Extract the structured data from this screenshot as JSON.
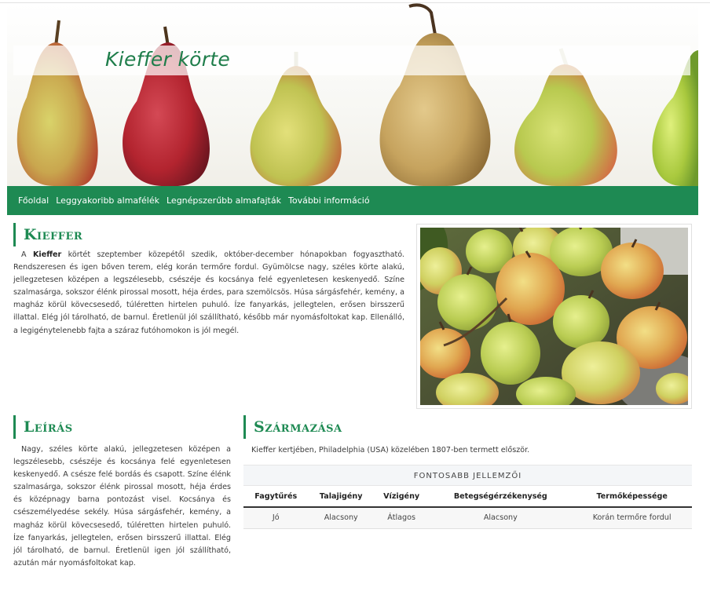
{
  "site": {
    "title": "Kieffer körte"
  },
  "nav": {
    "items": [
      "Főoldal",
      "Leggyakoribb almafélék",
      "Legnépszerűbb almafajták",
      "További információ"
    ]
  },
  "kieffer": {
    "heading": "Kieffer",
    "intro_prefix": "A",
    "intro_bold": "Kieffer",
    "body": "körtét szeptember közepétől szedik, október-december hónapokban fogyasztható. Rendszeresen és igen bőven terem, elég korán termőre fordul. Gyümölcse nagy, széles körte alakú, jellegzetesen középen a legszélesebb, csészéje és kocsánya felé egyenletesen keskenyedő. Színe szalmasárga, sokszor élénk pirossal mosott, héja érdes, para szemölcsös. Húsa sárgásfehér, kemény, a magház körül kövecsesedő, túléretten hirtelen puhuló. Íze fanyarkás, jellegtelen, erősen birsszerű illattal. Elég jól tárolható, de barnul. Éretlenül jól szállítható, később már nyomásfoltokat kap. Ellenálló, a legigénytelenebb fajta a száraz futóhomokon is jól megél."
  },
  "leiras": {
    "heading": "Leírás",
    "body": "Nagy, széles körte alakú, jellegzetesen középen a legszélesebb, csészéje és kocsánya felé egyenletesen keskenyedő. A csésze felé bordás és csapott. Színe élénk szalmasárga, sokszor élénk pirossal mosott, héja érdes és középnagy barna pontozást visel. Kocsánya és csészemélyedése sekély. Húsa sárgásfehér, kemény, a magház körül kövecsesedő, túléretten hirtelen puhuló. Íze fanyarkás, jellegtelen, erősen birsszerű illattal. Elég jól tárolható, de barnul. Éretlenül igen jól szállítható, azután már nyomásfoltokat kap."
  },
  "szarmazasa": {
    "heading": "Származása",
    "body": "Kieffer kertjében, Philadelphia (USA) közelében 1807-ben termett először."
  },
  "table": {
    "caption": "Fontosabb jellemzői",
    "headers": [
      "Fagytűrés",
      "Talajigény",
      "Vízigény",
      "Betegségérzékenység",
      "Termőképessége"
    ],
    "rows": [
      [
        "Jó",
        "Alacsony",
        "Átlagos",
        "Alacsony",
        "Korán termőre fordul"
      ]
    ]
  },
  "colors": {
    "accent": "#1e8a53",
    "title": "#1e7d4a"
  },
  "images": {
    "banner": "pears-row-banner",
    "photo": "pears-basket-photo"
  }
}
